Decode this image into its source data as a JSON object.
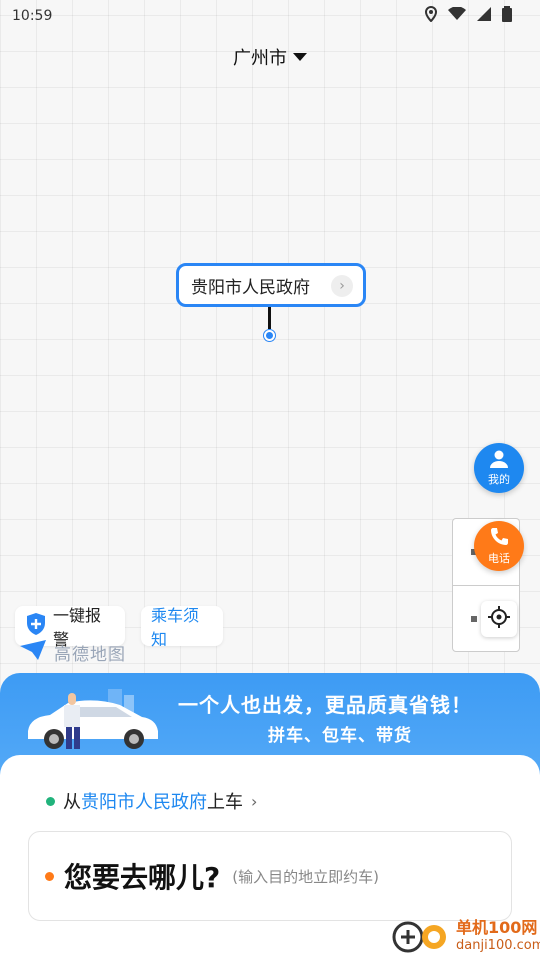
{
  "status_bar": {
    "time": "10:59"
  },
  "city": {
    "name": "广州市"
  },
  "pickup_bubble": {
    "label": "贵阳市人民政府"
  },
  "buttons": {
    "me": "我的",
    "phone": "电话"
  },
  "chips": {
    "sos": "一键报警",
    "notice": "乘车须知"
  },
  "map_logo": {
    "text": "高德地图"
  },
  "banner": {
    "headline": "一个人也出发，更品质真省钱！",
    "subline": "拼车、包车、带货"
  },
  "pickup_row": {
    "prefix": "从",
    "place": "贵阳市人民政府",
    "suffix": "上车"
  },
  "destination": {
    "title": "您要去哪儿?",
    "hint": "(输入目的地立即约车)"
  },
  "watermark": {
    "name": "单机100网",
    "url": "danji100.com"
  },
  "colors": {
    "accent": "#1e88f0",
    "orange": "#ff7a18",
    "green": "#21b37c"
  }
}
